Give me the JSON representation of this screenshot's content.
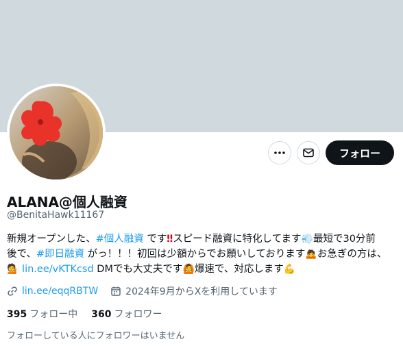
{
  "profile": {
    "display_name": "ALANA@個人融資",
    "handle": "@BenitaHawk11167",
    "follow_label": "フォロー",
    "bio": {
      "line1_a": "新規オープンした、",
      "tag1": "#個人融資",
      "line1_b": " です",
      "line1_c": "スピード融資に特化してます",
      "line1_d": "最短で30分前",
      "line2_a": "後で、",
      "tag2": "#即日融資",
      "line2_b": " がっ！！！初回は少額からでお願いしております",
      "line2_c": "お急ぎの方は、",
      "link": "lin.ee/vKTKcsd",
      "line3_a": " DMでも大丈夫です",
      "line3_b": "爆速で、対応します"
    },
    "website": "lin.ee/eqqRBTW",
    "joined": "2024年9月からXを利用しています",
    "following_count": "395",
    "following_label": "フォロー中",
    "followers_count": "360",
    "followers_label": "フォロワー",
    "mutuals_note": "フォローしている人にフォロワーはいません"
  },
  "icons": {
    "more": "more-icon",
    "message": "mail-icon",
    "link": "link-icon",
    "calendar": "calendar-icon"
  },
  "colors": {
    "banner": "#cfd9de",
    "accent": "#1d9bf0",
    "follow_button": "#0f1419"
  }
}
